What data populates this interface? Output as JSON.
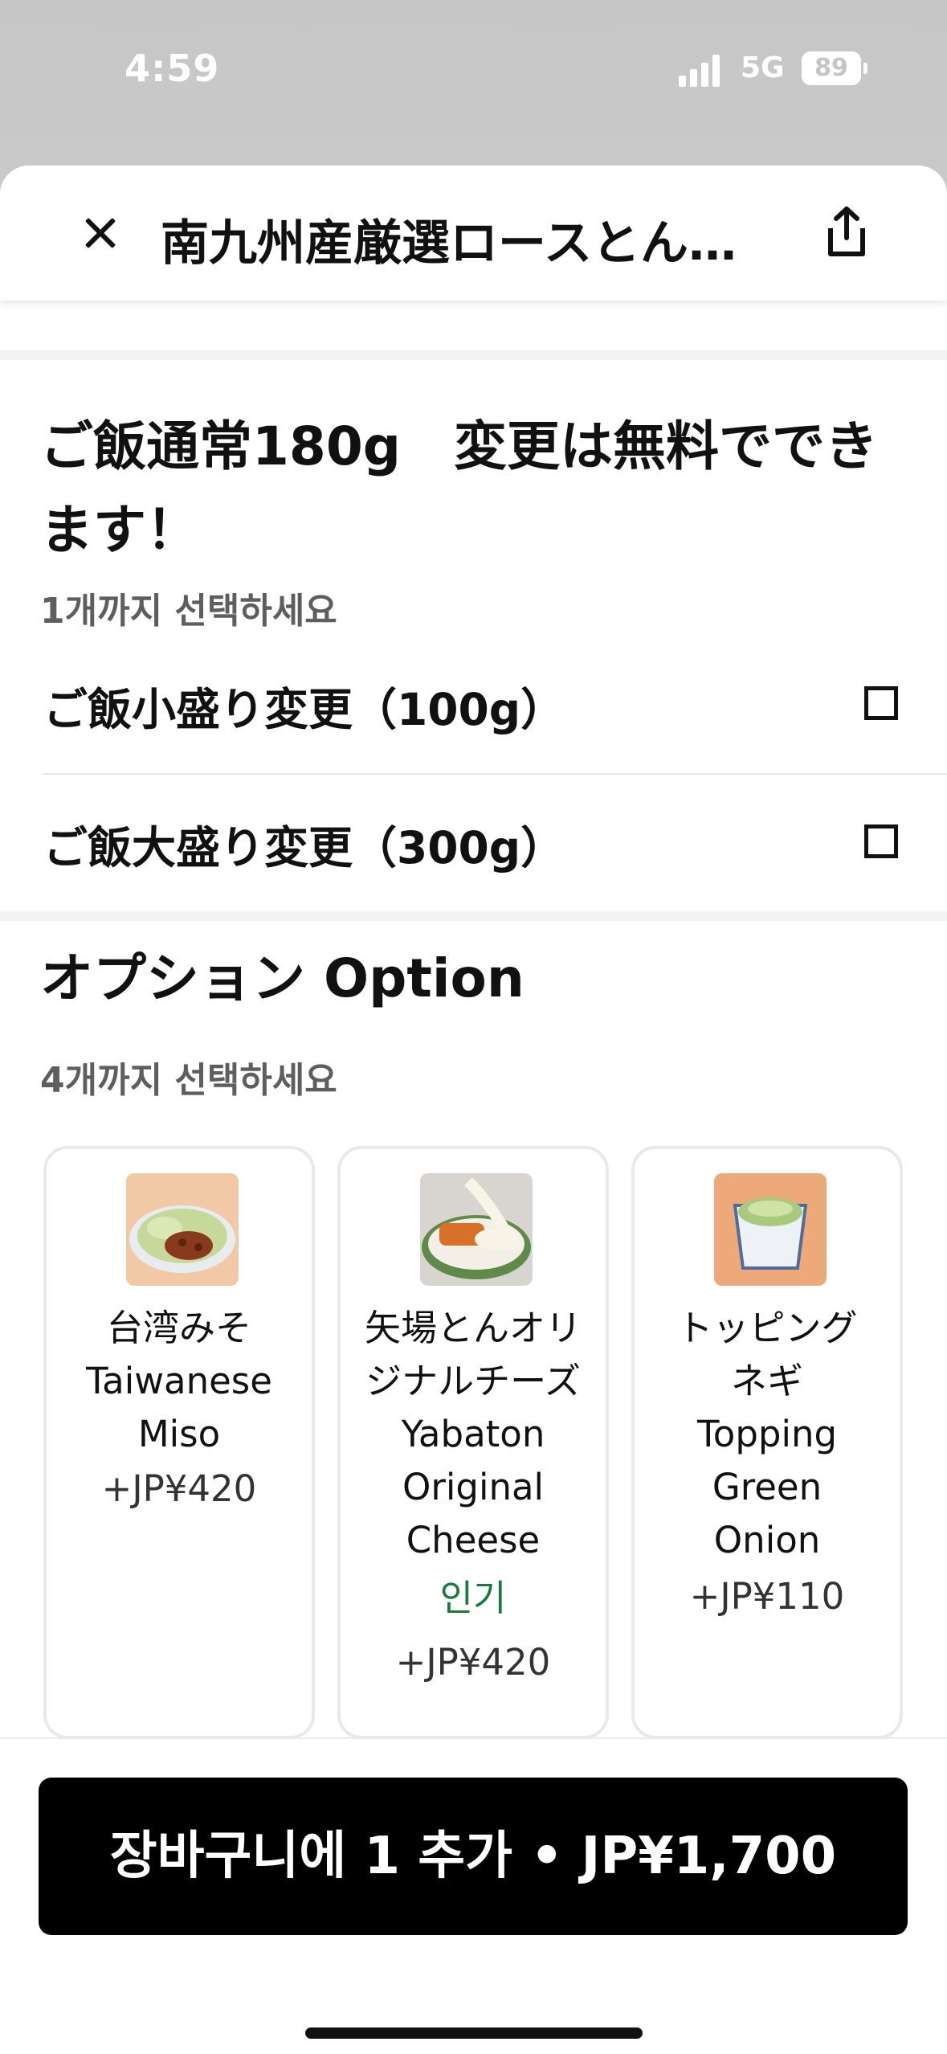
{
  "status_bar": {
    "time": "4:59",
    "network": "5G",
    "battery": "89"
  },
  "header": {
    "title": "南九州産厳選ロースとん…"
  },
  "rice_section": {
    "title": "ご飯通常180g　変更は無料でできます！",
    "subtitle": "1개까지 선택하세요",
    "options": [
      {
        "label": "ご飯小盛り変更（100g）",
        "checked": false
      },
      {
        "label": "ご飯大盛り変更（300g）",
        "checked": false
      }
    ]
  },
  "option_section": {
    "title": "オプション Option",
    "subtitle": "4개까지 선택하세요",
    "cards": [
      {
        "name": "台湾みそ\nTaiwanese\nMiso",
        "badge": "",
        "price": "+JP¥420",
        "image": "taiwanese-miso-photo"
      },
      {
        "name": "矢場とんオリ\nジナルチーズ\nYabaton\nOriginal\nCheese",
        "badge": "인기",
        "price": "+JP¥420",
        "image": "cheese-katsu-photo"
      },
      {
        "name": "トッピング\nネギ\nTopping\nGreen\nOnion",
        "badge": "",
        "price": "+JP¥110",
        "image": "green-onion-photo"
      }
    ]
  },
  "cart_button": {
    "label": "장바구니에 1 추가 • JP¥1,700"
  },
  "colors": {
    "badge_green": "#1b7a3b",
    "button_black": "#000000"
  }
}
